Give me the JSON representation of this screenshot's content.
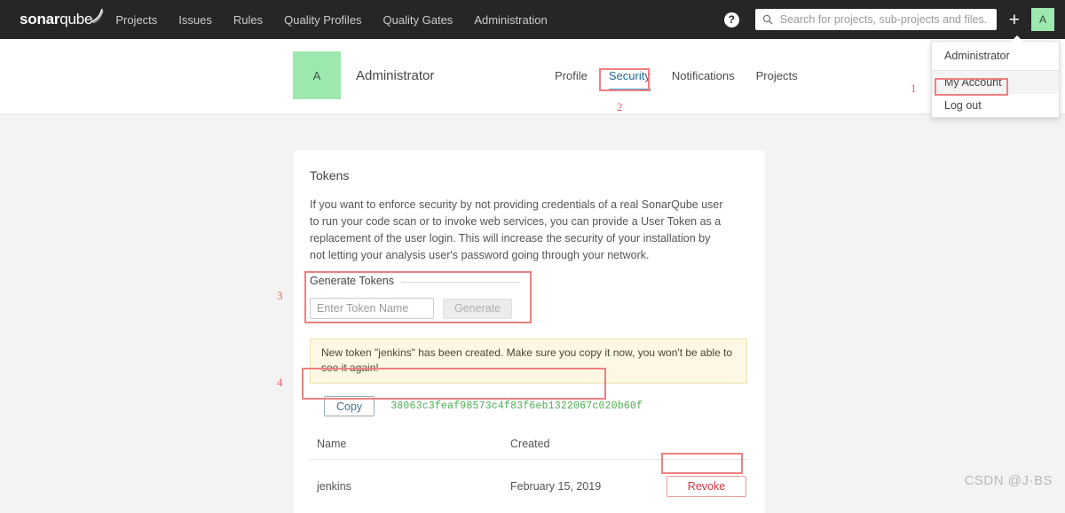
{
  "navbar": {
    "brand_bold": "sonar",
    "brand_light": "qube",
    "links": [
      {
        "label": "Projects"
      },
      {
        "label": "Issues"
      },
      {
        "label": "Rules"
      },
      {
        "label": "Quality Profiles"
      },
      {
        "label": "Quality Gates"
      },
      {
        "label": "Administration"
      }
    ],
    "help_icon": "question-mark-icon",
    "search_icon": "search-icon",
    "search_placeholder": "Search for projects, sub-projects and files...",
    "search_value": "",
    "plus_label": "+",
    "avatar_initial": "A",
    "avatar_color": "#9ce8ae"
  },
  "dropdown": {
    "header": "Administrator",
    "items": [
      {
        "label": "My Account",
        "highlighted": true
      },
      {
        "label": "Log out",
        "highlighted": false
      }
    ]
  },
  "profile": {
    "avatar_initial": "A",
    "name": "Administrator",
    "tabs": [
      {
        "label": "Profile",
        "active": false
      },
      {
        "label": "Security",
        "active": true
      },
      {
        "label": "Notifications",
        "active": false
      },
      {
        "label": "Projects",
        "active": false
      }
    ]
  },
  "card": {
    "title": "Tokens",
    "description": "If you want to enforce security by not providing credentials of a real SonarQube user to run your code scan or to invoke web services, you can provide a User Token as a replacement of the user login. This will increase the security of your installation by not letting your analysis user's password going through your network.",
    "generate": {
      "legend": "Generate Tokens",
      "input_placeholder": "Enter Token Name",
      "input_value": "",
      "button_label": "Generate"
    },
    "alert": "New token \"jenkins\" has been created. Make sure you copy it now, you won't be able to see it again!",
    "token_result": {
      "copy_label": "Copy",
      "value": "38063c3feaf98573c4f83f6eb1322067c020b60f",
      "value_color": "#4caf50"
    },
    "table": {
      "headers": [
        "Name",
        "Created",
        ""
      ],
      "rows": [
        {
          "name": "jenkins",
          "created": "February 15, 2019",
          "action": "Revoke"
        }
      ]
    }
  },
  "annotations": [
    {
      "number": "1"
    },
    {
      "number": "2"
    },
    {
      "number": "3"
    },
    {
      "number": "4"
    }
  ],
  "watermark": "CSDN @J·BS"
}
